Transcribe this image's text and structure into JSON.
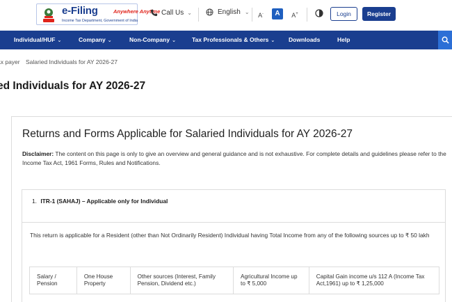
{
  "header": {
    "logo": {
      "brand": "e-Filing",
      "tagline": "Anywhere Anytime",
      "sub": "Income Tax Department, Government of India"
    },
    "call_us": "Call Us",
    "language": "English",
    "font_small": "A",
    "font_normal": "A",
    "font_large": "A",
    "login": "Login",
    "register": "Register"
  },
  "nav": {
    "items": [
      {
        "label": "Individual/HUF",
        "has_menu": true
      },
      {
        "label": "Company",
        "has_menu": true
      },
      {
        "label": "Non-Company",
        "has_menu": true
      },
      {
        "label": "Tax Professionals & Others",
        "has_menu": true
      },
      {
        "label": "Downloads",
        "has_menu": false
      },
      {
        "label": "Help",
        "has_menu": false
      }
    ],
    "chevron": "⌄"
  },
  "breadcrumb": {
    "parent": "ax payer",
    "current": "Salaried Individuals for AY 2026-27"
  },
  "page_title": "ed Individuals for AY 2026-27",
  "card": {
    "title": "Returns and Forms Applicable for Salaried Individuals for AY 2026-27",
    "disclaimer_label": "Disclaimer:",
    "disclaimer_text": " The content on this page is only to give an overview and general guidance and is not exhaustive. For complete details and guidelines please refer to the Income Tax Act, 1961 Forms, Rules and Notifications.",
    "itr": {
      "number": "1.",
      "heading": "ITR-1 (SAHAJ) – Applicable only for Individual",
      "description": "This return is applicable for a Resident (other than Not Ordinarily Resident) Individual having Total Income from any of the following sources up to ₹ 50 lakh",
      "sources": [
        "Salary / Pension",
        "One House Property",
        "Other sources (Interest, Family Pension, Dividend etc.)",
        "Agricultural Income up to ₹ 5,000",
        "Capital Gain income u/s 112 A (Income Tax Act,1961) up to ₹ 1,25,000"
      ]
    }
  },
  "colors": {
    "brand_blue": "#1a3e8f",
    "search_blue": "#2c6fd6",
    "tagline_red": "#e0231a"
  }
}
